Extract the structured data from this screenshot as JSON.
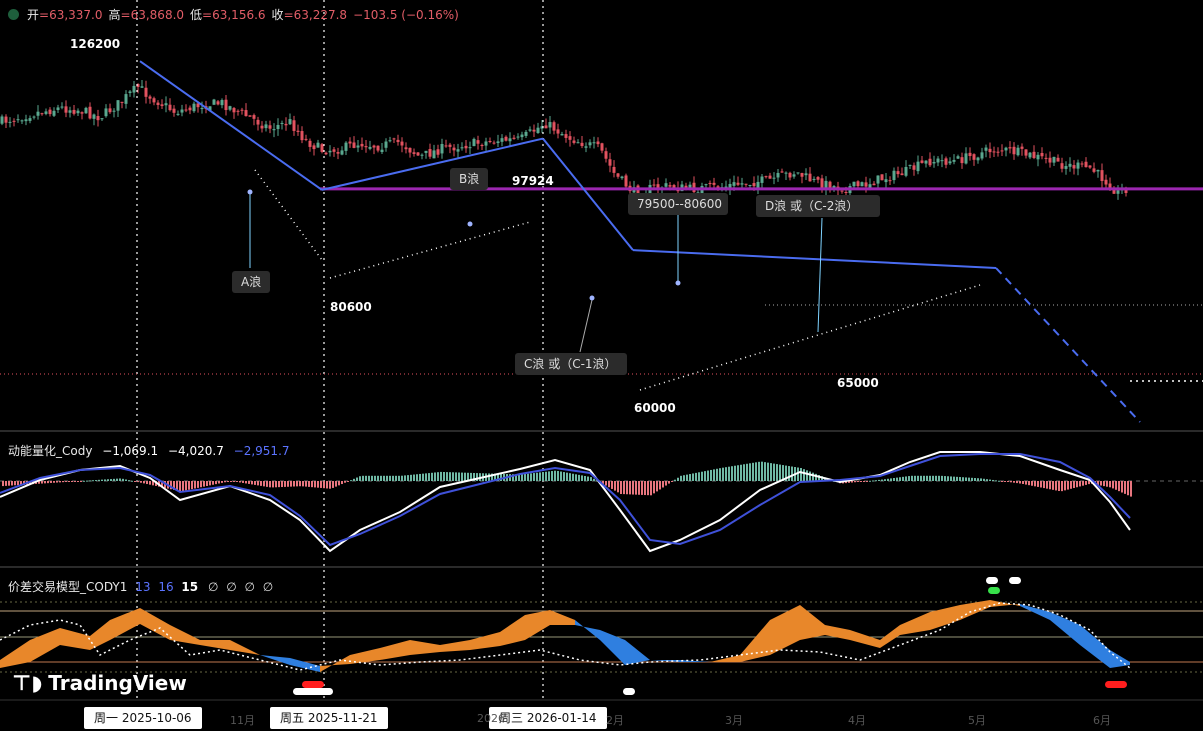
{
  "header": {
    "open_label": "开",
    "open_value": "=63,337.0",
    "high_label": "高",
    "high_value": "=63,868.0",
    "low_label": "低",
    "low_value": "=63,156.6",
    "close_label": "收",
    "close_value": "=63,227.8",
    "change": "−103.5 (−0.16%)"
  },
  "indicator1": {
    "name": "动能量化_Cody",
    "v1": "−1,069.1",
    "v2": "−4,020.7",
    "v3": "−2,951.7"
  },
  "indicator2": {
    "name": "价差交易模型_CODY1",
    "p1": "13",
    "p2": "16",
    "p3": "15",
    "flags": [
      "∅",
      "∅",
      "∅",
      "∅"
    ]
  },
  "logo": "TradingView",
  "date_labels": [
    "周一 2025-10-06",
    "周五 2025-11-21",
    "周三 2026-01-14"
  ],
  "month_labels": [
    "11月",
    "2026",
    "2月",
    "3月",
    "4月",
    "5月",
    "6月"
  ],
  "annotations": {
    "a_wave": "A浪",
    "b_wave": "B浪",
    "c_wave": "C浪 或（C-1浪）",
    "d_wave": "D浪 或（C-2浪）",
    "zone": "79500--80600"
  },
  "colors": {
    "up": "#5aa88f",
    "down": "#e2525f",
    "trend": "#4a6cf0",
    "level": "#9c27b0",
    "macd_fast": "#ffffff",
    "macd_slow": "#3f51d9",
    "area_up": "#e8872a",
    "area_down": "#2f7fe0"
  },
  "chart_data": {
    "type": "candlestick",
    "x": [
      "2025-10-06",
      "2025-11-21",
      "2026-01-14",
      "2026-02-05",
      "2026-04-10",
      "2026-04-30",
      "2026-05-28"
    ],
    "price_levels": [
      {
        "label": "126200",
        "value": 126200,
        "x": "2025-10-06"
      },
      {
        "label": "80600",
        "value": 80600,
        "x": "2025-11-21"
      },
      {
        "label": "97924",
        "value": 97924,
        "x": "2026-01-14"
      },
      {
        "label": "60000",
        "value": 60000,
        "x": "2026-02-05"
      },
      {
        "label": "65000",
        "value": 65000,
        "x": "2026-04-10"
      }
    ],
    "horizontal_line": 80600,
    "last_close": 63227.8
  }
}
